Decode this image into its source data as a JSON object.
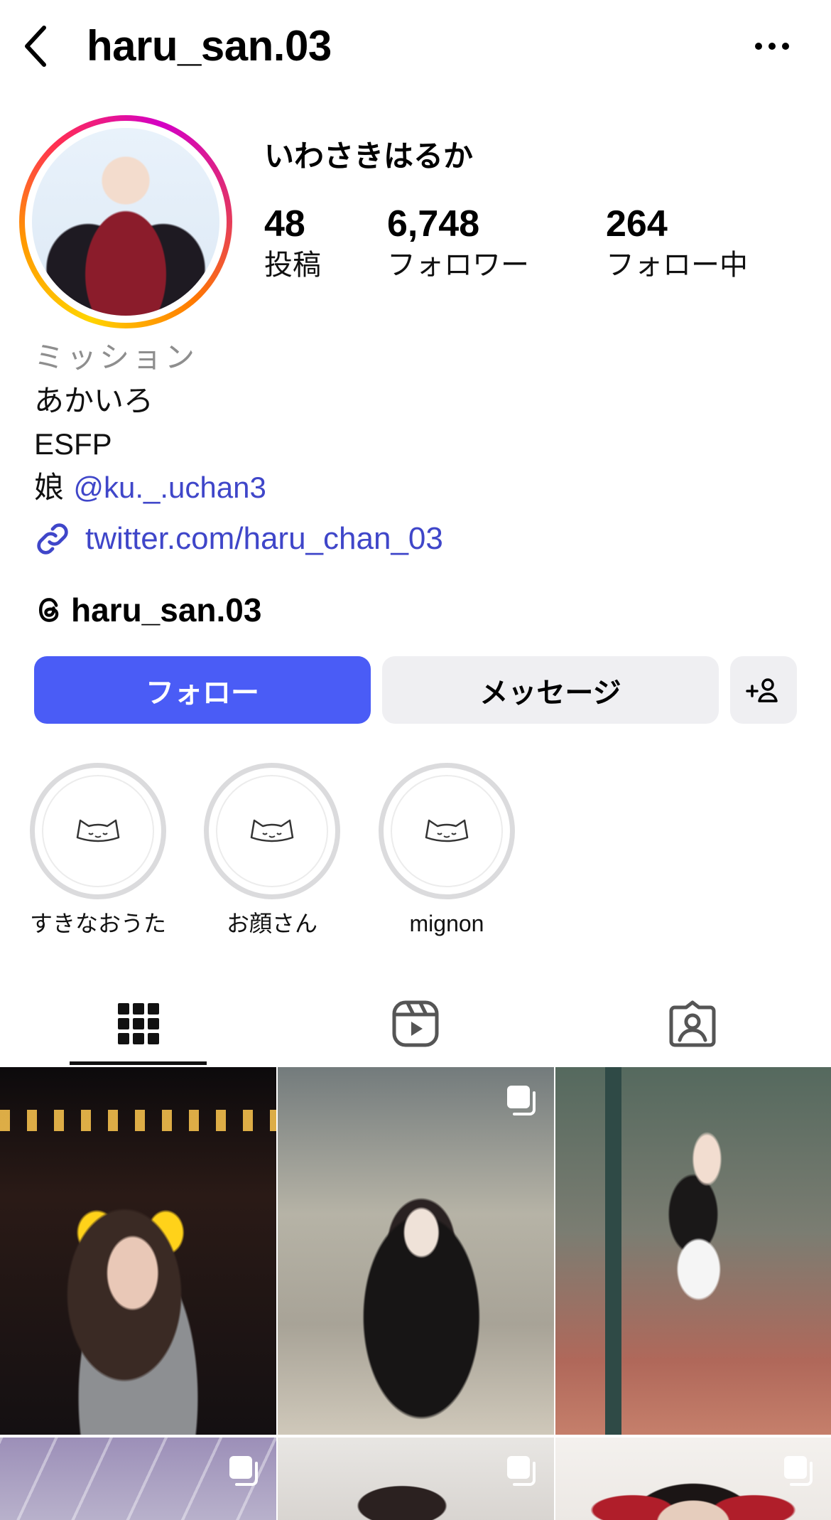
{
  "header": {
    "username": "haru_san.03"
  },
  "profile": {
    "display_name": "いわさきはるか",
    "stats": [
      {
        "value": "48",
        "label": "投稿"
      },
      {
        "value": "6,748",
        "label": "フォロワー"
      },
      {
        "value": "264",
        "label": "フォロー中"
      }
    ],
    "category": "ミッション",
    "bio_lines": [
      "あかいろ",
      "ESFP"
    ],
    "bio_relation_prefix": "娘 ",
    "bio_mention": "@ku._.uchan3",
    "link": "twitter.com/haru_chan_03",
    "threads_name": "haru_san.03"
  },
  "actions": {
    "follow_label": "フォロー",
    "message_label": "メッセージ"
  },
  "highlights": [
    {
      "label": "すきなおうた"
    },
    {
      "label": "お顔さん"
    },
    {
      "label": "mignon"
    }
  ],
  "tabs": [
    "grid-icon",
    "reels-icon",
    "tagged-icon"
  ],
  "colors": {
    "accent_blue": "#4a5cf6",
    "link_blue": "#3f46c9",
    "secondary_button": "#efeff2",
    "muted_text": "#8e8e8e"
  }
}
